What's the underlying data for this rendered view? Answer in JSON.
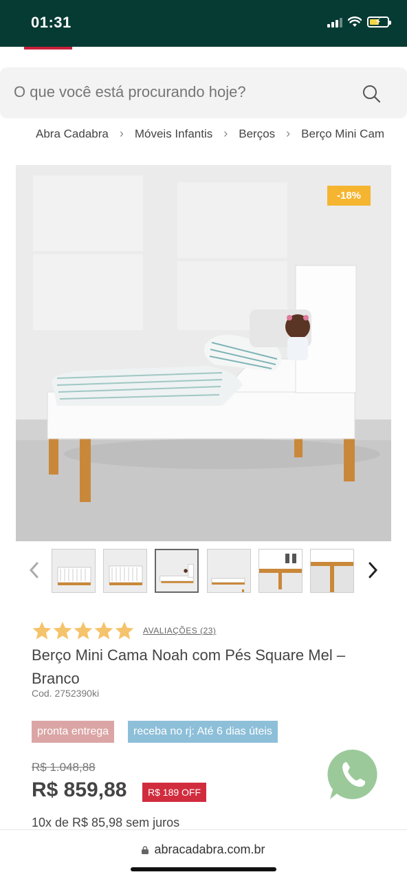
{
  "status_bar": {
    "time": "01:31",
    "battery_level": 0.55,
    "signal_bars": 3,
    "color": "#063b34"
  },
  "search": {
    "placeholder": "O que você está procurando hoje?"
  },
  "breadcrumb": [
    "Abra Cadabra",
    "Móveis Infantis",
    "Berços",
    "Berço Mini Cam"
  ],
  "product": {
    "discount_badge": "-18%",
    "rating": 5,
    "reviews_label": "AVALIAÇÕES (23)",
    "title": "Berço Mini Cama Noah com Pés Square Mel – Branco",
    "code": "Cod. 2752390ki",
    "tags": [
      "pronta entrega",
      "receba no rj: Até 6 dias úteis"
    ],
    "old_price": "R$ 1.048,88",
    "price": "R$ 859,88",
    "off_badge": "R$ 189 OFF",
    "installments": "10x de R$ 85,98 sem juros"
  },
  "thumbnails": {
    "count": 6,
    "active_index": 2
  },
  "browser": {
    "url": "abracadabra.com.br"
  },
  "colors": {
    "accent": "#c8203a",
    "discount": "#f5b531",
    "star": "#f5c36b",
    "off_badge": "#d12c3e",
    "whatsapp": "#9cc99a"
  }
}
